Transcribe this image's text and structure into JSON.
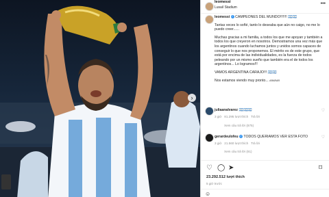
{
  "post": {
    "username": "leomessi",
    "location": "Lusail Stadium",
    "caption": {
      "headline": "CAMPEONES DEL MUNDO!!!!!!!",
      "p1": "Tantas veces lo soñé, tanto lo deseaba que aún no caigo, no me lo puedo creer......",
      "p2": "Muchas gracias a mi familia, a todos los que me apoyan y también a todos los que creyeron en nosotros. Demostramos una vez más que los argentinos cuando luchamos juntos y unidos somos capaces de conseguir lo que nos proponemos. El mérito es de este grupo, que está por encima de las individualidades, es la fuerza de todos peleando por un mismo sueño que también era el de todos los argentinos... Lo logramos!!!",
      "p3": "VAMOS ARGENTINA CARAJO!!!",
      "p4": "Nos estamos viendo muy pronto...",
      "emoji_flags": "🇦🇷🇦🇷",
      "tag": "ARARAR"
    },
    "comments": [
      {
        "user": "juliaanalvarez",
        "text": "🇦🇷🇦🇷🇦🇷",
        "time": "3 giờ",
        "likes": "81.295 lượt thích",
        "reply": "Trả lời",
        "replies": "Xem câu trả lời (875)"
      },
      {
        "user": "gerardeulofeu",
        "text": "TODOS QUERIAMOS VER ESTA FOTO",
        "time": "3 giờ",
        "likes": "21.560 lượt thích",
        "reply": "Trả lời",
        "replies": "Xem câu trả lời (61)"
      }
    ],
    "likes_count": "23.292.512 lượt thích",
    "posted_ago": "5 giờ trước",
    "colors": {
      "verified": "#3897f0",
      "argentina_blue": "#75aadb",
      "trophy_gold": "#c9a227"
    },
    "icons": [
      "heart-icon",
      "comment-icon",
      "share-icon",
      "bookmark-icon",
      "emoji-icon",
      "more-icon",
      "next-arrow-icon"
    ]
  }
}
